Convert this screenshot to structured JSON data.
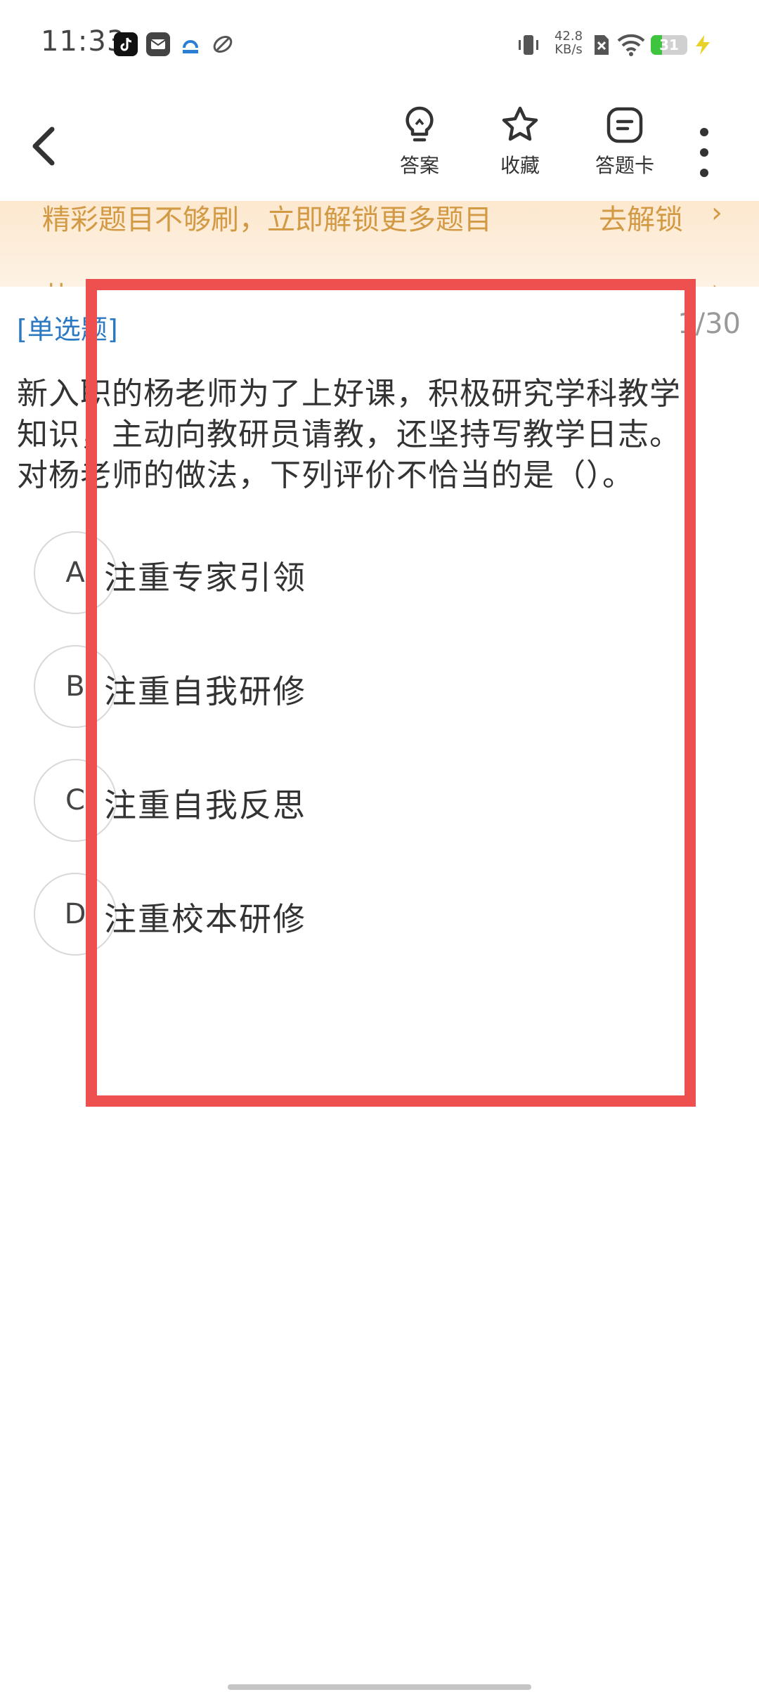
{
  "status_bar": {
    "time": "11:33",
    "net_speed_value": "42.8",
    "net_speed_unit": "KB/s",
    "battery_level": "31",
    "battery_fraction": 0.31,
    "icons": [
      "tiktok-icon",
      "mail-app-icon",
      "bank-app-icon",
      "browser-app-icon",
      "vibrate-icon",
      "no-sim-icon",
      "wifi-icon",
      "battery-icon",
      "charging-icon"
    ]
  },
  "topnav": {
    "answer_label": "答案",
    "favorite_label": "收藏",
    "answer_card_label": "答题卡"
  },
  "promo": {
    "text": "精彩题目不够刷，立即解锁更多题目",
    "action": "去解锁",
    "chevron": "›",
    "sub_partial": "共"
  },
  "question": {
    "type": "[单选题]",
    "counter": "1/30",
    "line1": "新入职的杨老师为了上好课，积极研究学科教学",
    "line2": "知识，主动向教研员请教，还坚持写教学日志。",
    "line3": "对杨老师的做法，下列评价不恰当的是（）。",
    "options": [
      {
        "letter": "A",
        "text": "注重专家引领"
      },
      {
        "letter": "B",
        "text": "注重自我研修"
      },
      {
        "letter": "C",
        "text": "注重自我反思"
      },
      {
        "letter": "D",
        "text": "注重校本研修"
      }
    ]
  },
  "colors": {
    "accent_blue": "#2b79c2",
    "promo_text": "#d39a45",
    "annotation_red": "#ee5050"
  }
}
